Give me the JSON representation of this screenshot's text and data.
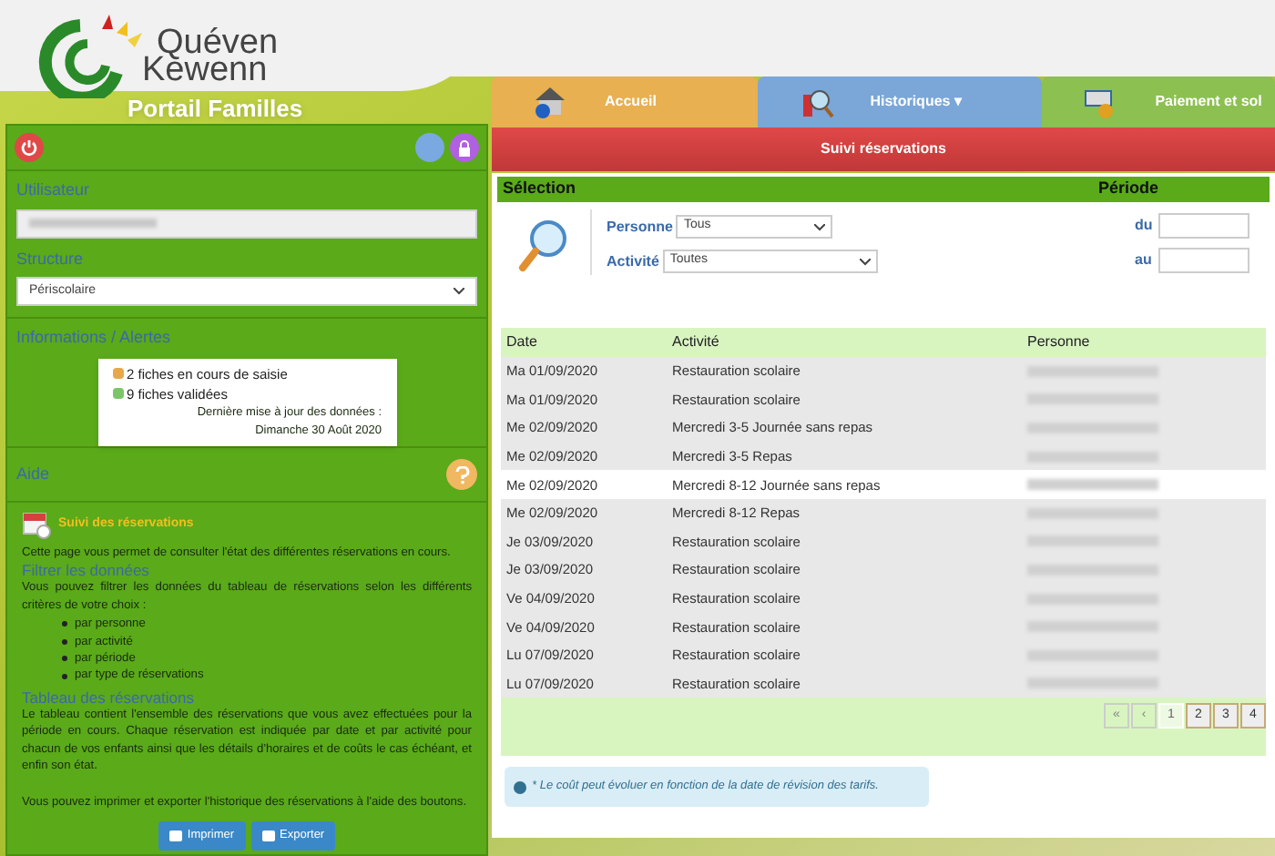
{
  "logo": {
    "line_1": "Quéven",
    "line_2": "Kewenn"
  },
  "portal_title": "Portail Familles",
  "sidebar": {
    "user_label": "Utilisateur",
    "structure_label": "Structure",
    "structure_value": "Périscolaire",
    "info_title": "Informations / Alertes",
    "alerts": [
      {
        "text": "2 fiches en cours de saisie",
        "color": "#e8a84a"
      },
      {
        "text": "9 fiches validées",
        "color": "#7cc46a"
      }
    ],
    "update_label": "Dernière mise à jour des données :",
    "update_date": "Dimanche 30 Août 2020",
    "help_title": "Aide",
    "help_heading": "Suivi des réservations",
    "help_intro": "Cette page vous permet de consulter l'état des différentes réservations en cours.",
    "filter_title": "Filtrer les données",
    "filter_text": "Vous pouvez filtrer les données du tableau de réservations selon les différents critères de votre choix :",
    "filter_items": [
      "par personne",
      "par activité",
      "par période",
      "par type de réservations"
    ],
    "table_title": "Tableau des réservations",
    "table_text": "Le tableau contient l'ensemble des réservations que vous avez effectuées pour la période en cours. Chaque réservation est indiquée par date et par activité pour chacun de vos enfants ainsi que les détails d'horaires et de coûts le cas échéant, et enfin son état.",
    "export_text": "Vous pouvez imprimer et exporter l'historique des réservations à l'aide des boutons.",
    "buttons": [
      "Imprimer",
      "Exporter"
    ]
  },
  "tabs": [
    {
      "label": "Accueil",
      "kind": "home"
    },
    {
      "label": "Historiques ▾",
      "kind": "history"
    },
    {
      "label": "Paiement et sol",
      "kind": "payment"
    }
  ],
  "subtab": "Suivi réservations",
  "selection": {
    "title": "Sélection",
    "period_title": "Période",
    "person_label": "Personne",
    "person_value": "Tous",
    "activity_label": "Activité",
    "activity_value": "Toutes",
    "from_label": "du",
    "to_label": "au"
  },
  "table": {
    "columns": [
      "Date",
      "Activité",
      "Personne"
    ],
    "rows": [
      {
        "date": "Ma 01/09/2020",
        "activity": "Restauration scolaire",
        "selected": false
      },
      {
        "date": "Ma 01/09/2020",
        "activity": "Restauration scolaire",
        "selected": false
      },
      {
        "date": "Me 02/09/2020",
        "activity": "Mercredi 3-5 Journée sans repas",
        "selected": false
      },
      {
        "date": "Me 02/09/2020",
        "activity": "Mercredi 3-5 Repas",
        "selected": false
      },
      {
        "date": "Me 02/09/2020",
        "activity": "Mercredi 8-12 Journée sans repas",
        "selected": true
      },
      {
        "date": "Me 02/09/2020",
        "activity": "Mercredi 8-12 Repas",
        "selected": false
      },
      {
        "date": "Je 03/09/2020",
        "activity": "Restauration scolaire",
        "selected": false
      },
      {
        "date": "Je 03/09/2020",
        "activity": "Restauration scolaire",
        "selected": false
      },
      {
        "date": "Ve 04/09/2020",
        "activity": "Restauration scolaire",
        "selected": false
      },
      {
        "date": "Ve 04/09/2020",
        "activity": "Restauration scolaire",
        "selected": false
      },
      {
        "date": "Lu 07/09/2020",
        "activity": "Restauration scolaire",
        "selected": false
      },
      {
        "date": "Lu 07/09/2020",
        "activity": "Restauration scolaire",
        "selected": false
      }
    ]
  },
  "pagination": [
    {
      "label": "«",
      "selected": false
    },
    {
      "label": "‹",
      "selected": false
    },
    {
      "label": "1",
      "selected": true
    },
    {
      "label": "2",
      "selected": false
    },
    {
      "label": "3",
      "selected": false
    },
    {
      "label": "4",
      "selected": false
    }
  ],
  "note": "* Le coût peut évoluer en fonction de la date de révision des tarifs."
}
